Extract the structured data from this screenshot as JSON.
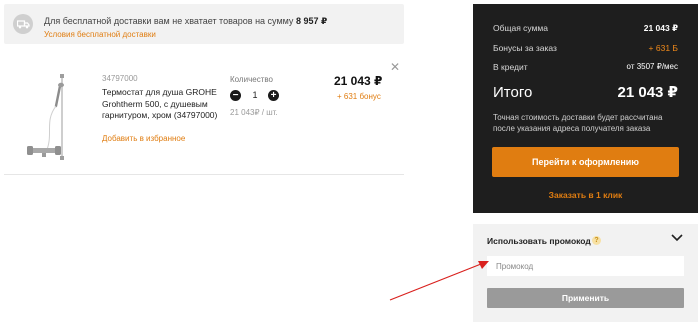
{
  "banner": {
    "text_prefix": "Для бесплатной доставки вам не хватает товаров на сумму",
    "amount": "8 957 ₽",
    "link": "Условия бесплатной доставки",
    "icon": "truck-icon"
  },
  "product": {
    "sku": "34797000",
    "name": "Термостат для душа GROHE Grohtherm 500, с душевым гарнитуром, хром (34797000)",
    "favorite_link": "Добавить в избранное",
    "quantity_label": "Количество",
    "quantity": "1",
    "minus": "−",
    "plus": "+",
    "unit_price": "21 043₽ / шт.",
    "price": "21 043 ₽",
    "bonus": "+ 631 бонус",
    "remove_icon": "close-icon",
    "remove_glyph": "✕"
  },
  "summary": {
    "total_sum_label": "Общая сумма",
    "total_sum_value": "21 043 ₽",
    "bonus_label": "Бонусы за заказ",
    "bonus_value": "+ 631 Б",
    "credit_label": "В кредит",
    "credit_value": "от 3507 ₽/мес",
    "grand_total_label": "Итого",
    "grand_total_value": "21 043 ₽",
    "note": "Точная стоимость доставки будет рассчитана после указания адреса получателя заказа",
    "checkout_button": "Перейти к оформлению",
    "one_click_link": "Заказать в 1 клик"
  },
  "promo": {
    "title": "Использовать промокод",
    "help_icon": "question-icon",
    "help_glyph": "?",
    "input_value": "",
    "input_placeholder": "Промокод",
    "apply_button": "Применить"
  },
  "colors": {
    "accent": "#e07d11",
    "dark_panel": "#1e1e1e",
    "light_panel": "#f2f2f2",
    "disabled_button": "#9a9a9a",
    "annotation_arrow": "#d9201d"
  }
}
